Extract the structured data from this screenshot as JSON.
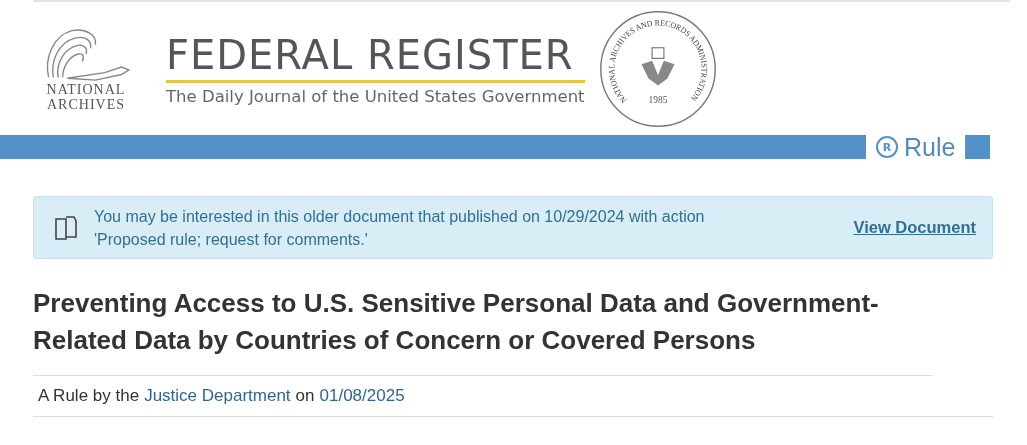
{
  "header": {
    "archives_logo": {
      "line_1": "NATIONAL",
      "line_2": "ARCHIVES"
    },
    "title": "FEDERAL REGISTER",
    "subtitle": "The Daily Journal of the United States Government",
    "seal": {
      "ring_text": "NATIONAL ARCHIVES AND RECORDS ADMINISTRATION",
      "year": "1985"
    }
  },
  "document_type": {
    "symbol": "R",
    "label": "Rule"
  },
  "notice": {
    "line_1": "You may be interested in this older document that published on 10/29/2024 with action",
    "line_2": "'Proposed rule; request for comments.'",
    "link": "View Document"
  },
  "title": "Preventing Access to U.S. Sensitive Personal Data and Government-Related Data by Countries of Concern or Covered Persons",
  "byline": {
    "prefix": "A Rule by the",
    "agency": "Justice Department",
    "middle": "on",
    "date": "01/08/2025"
  }
}
